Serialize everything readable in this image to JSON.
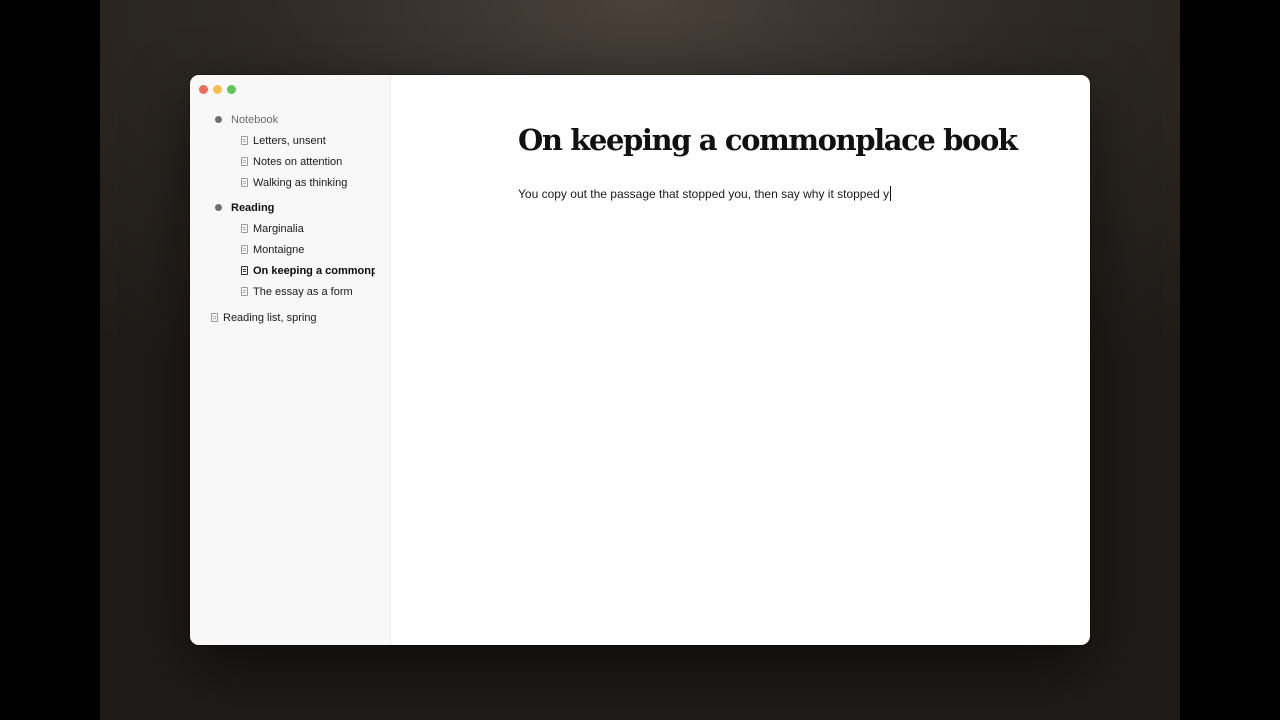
{
  "sidebar": {
    "groups": [
      {
        "label": "Notebook",
        "items": [
          "Letters, unsent",
          "Notes on attention",
          "Walking as thinking"
        ]
      },
      {
        "label": "Reading",
        "items": [
          "Marginalia",
          "Montaigne",
          "On keeping a commonplace book",
          "The essay as a form"
        ]
      }
    ],
    "top_items": [
      "Reading list, spring"
    ]
  },
  "document": {
    "title": "On keeping a commonplace book",
    "body": "You copy out the passage that stopped you, then say why it stopped y"
  }
}
